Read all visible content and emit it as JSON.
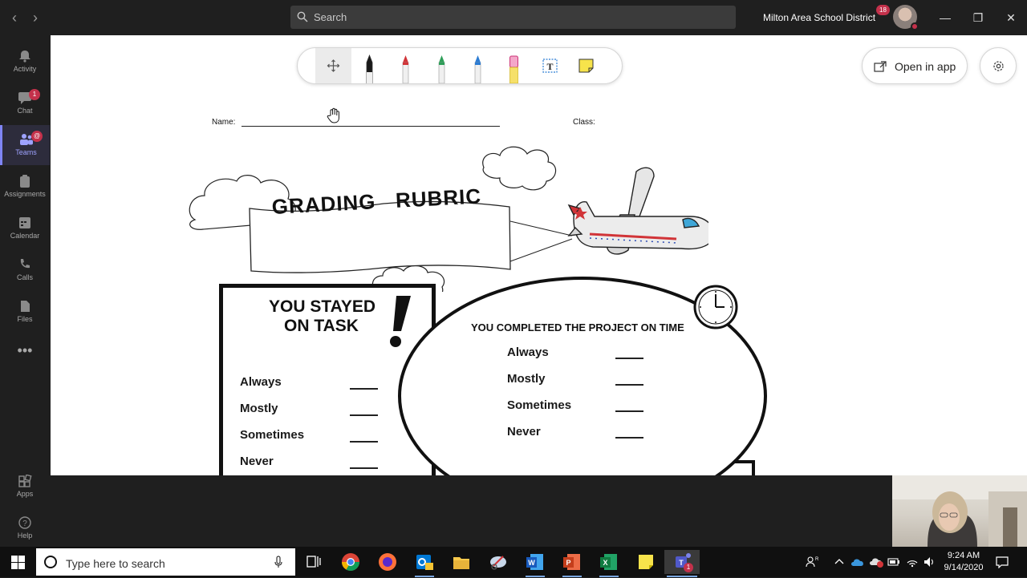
{
  "titlebar": {
    "back_icon": "chevron-left-icon",
    "forward_icon": "chevron-right-icon",
    "search_placeholder": "Search",
    "org_name": "Milton Area School District",
    "org_badge": "18",
    "window_controls": [
      "minimize-icon",
      "restore-icon",
      "close-icon"
    ]
  },
  "rail": {
    "items": [
      {
        "label": "Activity",
        "icon": "bell-icon",
        "badge": ""
      },
      {
        "label": "Chat",
        "icon": "chat-icon",
        "badge": "1"
      },
      {
        "label": "Teams",
        "icon": "teams-icon",
        "badge": "@"
      },
      {
        "label": "Assignments",
        "icon": "assignments-icon",
        "badge": ""
      },
      {
        "label": "Calendar",
        "icon": "calendar-icon",
        "badge": ""
      },
      {
        "label": "Calls",
        "icon": "phone-icon",
        "badge": ""
      },
      {
        "label": "Files",
        "icon": "files-icon",
        "badge": ""
      }
    ],
    "more_icon": "more-icon",
    "apps_label": "Apps",
    "help_label": "Help",
    "active": "Teams"
  },
  "toolbar": {
    "tools": [
      "move-icon",
      "black-pen-icon",
      "red-pen-icon",
      "green-pen-icon",
      "blue-pen-icon",
      "eraser-icon",
      "text-tool-icon",
      "sticky-note-icon"
    ],
    "selected": "move-icon",
    "pen_colors": {
      "black": "#1a1a1a",
      "red": "#d13438",
      "green": "#2e9e58",
      "blue": "#2b7cd3",
      "eraser": "#f4a7c9",
      "sticky": "#f7e34b"
    }
  },
  "board": {
    "open_in_app": "Open in app",
    "settings_icon": "gear-icon",
    "name_label": "Name:",
    "class_label": "Class:",
    "banner_title": "GRADING   RUBRIC",
    "box1_title_line1": "YOU STAYED",
    "box1_title_line2": "ON TASK",
    "box1_options": [
      "Always",
      "Mostly",
      "Sometimes",
      "Never"
    ],
    "box2_title": "YOU COMPLETED THE PROJECT ON TIME",
    "box2_options": [
      "Always",
      "Mostly",
      "Sometimes",
      "Never"
    ]
  },
  "taskbar": {
    "search_placeholder": "Type here to search",
    "apps": [
      "task-view-icon",
      "chrome-icon",
      "firefox-icon",
      "outlook-icon",
      "file-explorer-icon",
      "snipping-icon",
      "word-icon",
      "powerpoint-icon",
      "excel-icon",
      "sticky-notes-icon",
      "teams-icon"
    ],
    "teams_badge": "1",
    "time": "9:24 AM",
    "date": "9/14/2020"
  }
}
